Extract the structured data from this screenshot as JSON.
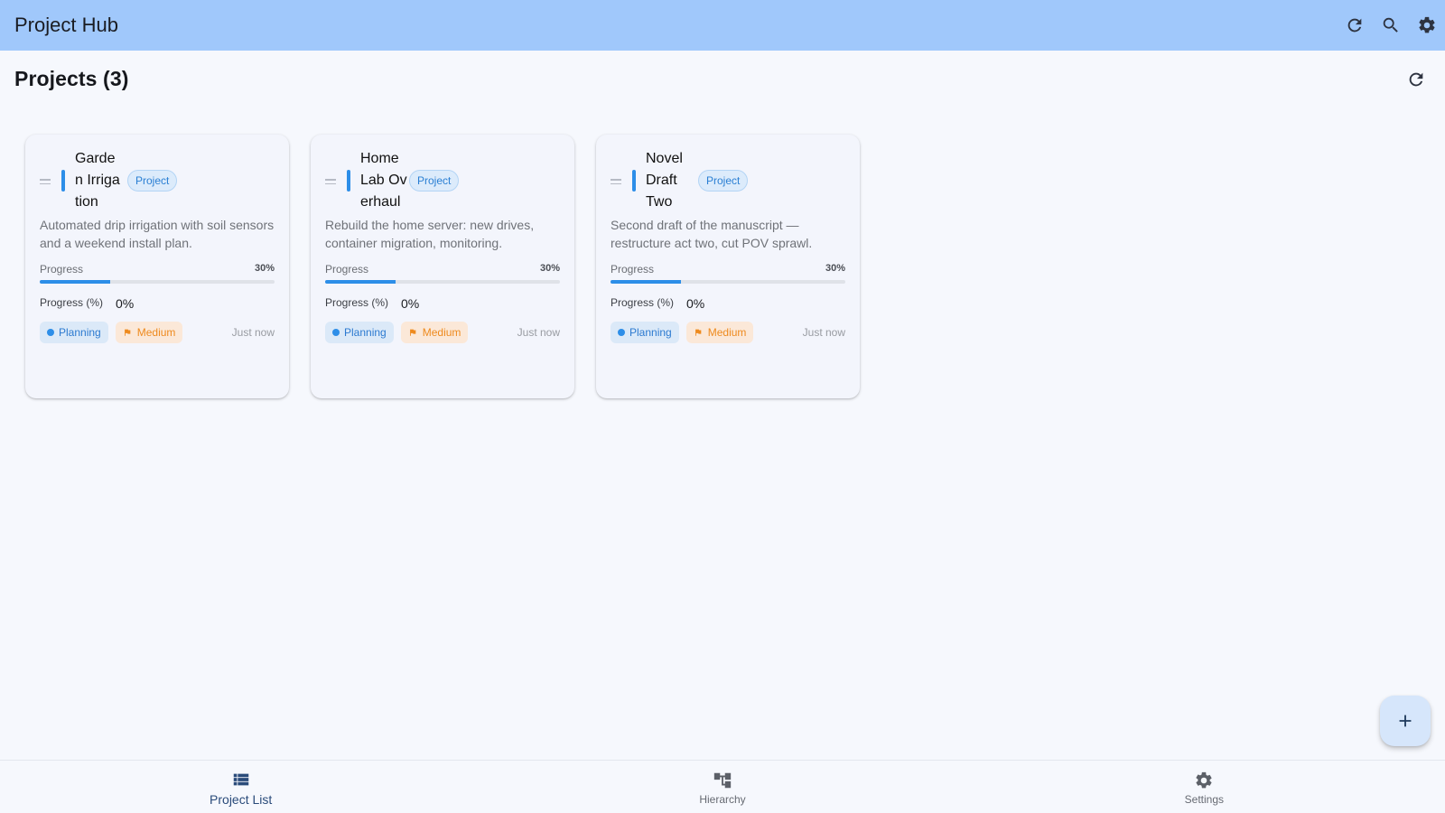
{
  "app": {
    "title": "Project Hub",
    "actions": [
      {
        "name": "refresh",
        "icon": "refresh-icon"
      },
      {
        "name": "search",
        "icon": "search-icon"
      },
      {
        "name": "settings",
        "icon": "gear-icon"
      }
    ]
  },
  "page": {
    "title": "Projects (3)"
  },
  "projects": [
    {
      "name": "Garden Irrigation",
      "type": "Project",
      "description": "Automated drip irrigation with soil sensors and a weekend install plan.",
      "progress_label": "Progress",
      "progress_text": "30%",
      "progress_value": 30,
      "field_label": "Progress (%)",
      "field_value": "0%",
      "status": "Planning",
      "priority": "Medium",
      "updated": "Just now"
    },
    {
      "name": "Home Lab Overhaul",
      "type": "Project",
      "description": "Rebuild the home server: new drives, container migration, monitoring.",
      "progress_label": "Progress",
      "progress_text": "30%",
      "progress_value": 30,
      "field_label": "Progress (%)",
      "field_value": "0%",
      "status": "Planning",
      "priority": "Medium",
      "updated": "Just now"
    },
    {
      "name": "Novel Draft Two",
      "type": "Project",
      "description": "Second draft of the manuscript — restructure act two, cut POV sprawl.",
      "progress_label": "Progress",
      "progress_text": "30%",
      "progress_value": 30,
      "field_label": "Progress (%)",
      "field_value": "0%",
      "status": "Planning",
      "priority": "Medium",
      "updated": "Just now"
    }
  ],
  "colors": {
    "accent": "#2d8ee8",
    "appbar": "#a0c8fb",
    "priority_medium": "#ee8a1e"
  },
  "fab": {
    "icon": "plus-icon"
  },
  "bottom_nav": {
    "items": [
      {
        "label": "Project List",
        "icon": "list-icon",
        "active": true
      },
      {
        "label": "Hierarchy",
        "icon": "hierarchy-icon",
        "active": false
      },
      {
        "label": "Settings",
        "icon": "gear-icon",
        "active": false
      }
    ]
  }
}
